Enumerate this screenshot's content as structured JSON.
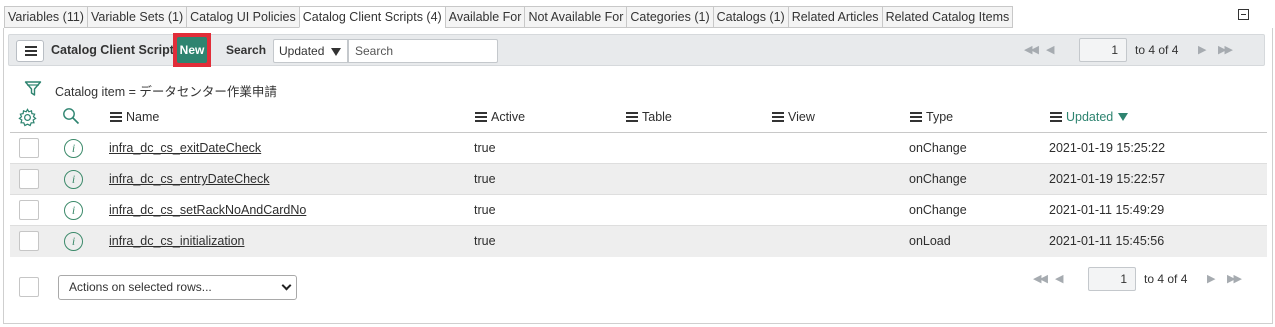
{
  "tabs": [
    {
      "label": "Variables (11)",
      "active": false
    },
    {
      "label": "Variable Sets (1)",
      "active": false
    },
    {
      "label": "Catalog UI Policies",
      "active": false
    },
    {
      "label": "Catalog Client Scripts (4)",
      "active": true
    },
    {
      "label": "Available For",
      "active": false
    },
    {
      "label": "Not Available For",
      "active": false
    },
    {
      "label": "Categories (1)",
      "active": false
    },
    {
      "label": "Catalogs (1)",
      "active": false
    },
    {
      "label": "Related Articles",
      "active": false
    },
    {
      "label": "Related Catalog Items",
      "active": false
    }
  ],
  "toolbar": {
    "title": "Catalog Client Scripts",
    "new_label": "New",
    "search_label": "Search",
    "search_field": "Updated",
    "search_placeholder": "Search"
  },
  "pager_top": {
    "page": "1",
    "range": "to 4 of 4"
  },
  "pager_bottom": {
    "page": "1",
    "range": "to 4 of 4"
  },
  "filter": {
    "text": "Catalog item = データセンター作業申請"
  },
  "columns": {
    "name": "Name",
    "active": "Active",
    "table": "Table",
    "view": "View",
    "type": "Type",
    "updated": "Updated",
    "sorted_column": "Updated",
    "sort_direction": "descending"
  },
  "rows": [
    {
      "name": "infra_dc_cs_exitDateCheck",
      "active": "true",
      "table": "",
      "view": "",
      "type": "onChange",
      "updated": "2021-01-19 15:25:22"
    },
    {
      "name": "infra_dc_cs_entryDateCheck",
      "active": "true",
      "table": "",
      "view": "",
      "type": "onChange",
      "updated": "2021-01-19 15:22:57"
    },
    {
      "name": "infra_dc_cs_setRackNoAndCardNo",
      "active": "true",
      "table": "",
      "view": "",
      "type": "onChange",
      "updated": "2021-01-11 15:49:29"
    },
    {
      "name": "infra_dc_cs_initialization",
      "active": "true",
      "table": "",
      "view": "",
      "type": "onLoad",
      "updated": "2021-01-11 15:45:56"
    }
  ],
  "footer": {
    "actions_label": "Actions on selected rows..."
  },
  "colors": {
    "accent": "#2e8470",
    "highlight": "#e12d39"
  },
  "icons": [
    "menu-icon",
    "first-page-icon",
    "prev-page-icon",
    "next-page-icon",
    "last-page-icon",
    "collapse-icon",
    "filter-funnel-icon",
    "gear-icon",
    "search-icon",
    "info-icon",
    "sort-down-icon",
    "chevron-down-icon"
  ]
}
